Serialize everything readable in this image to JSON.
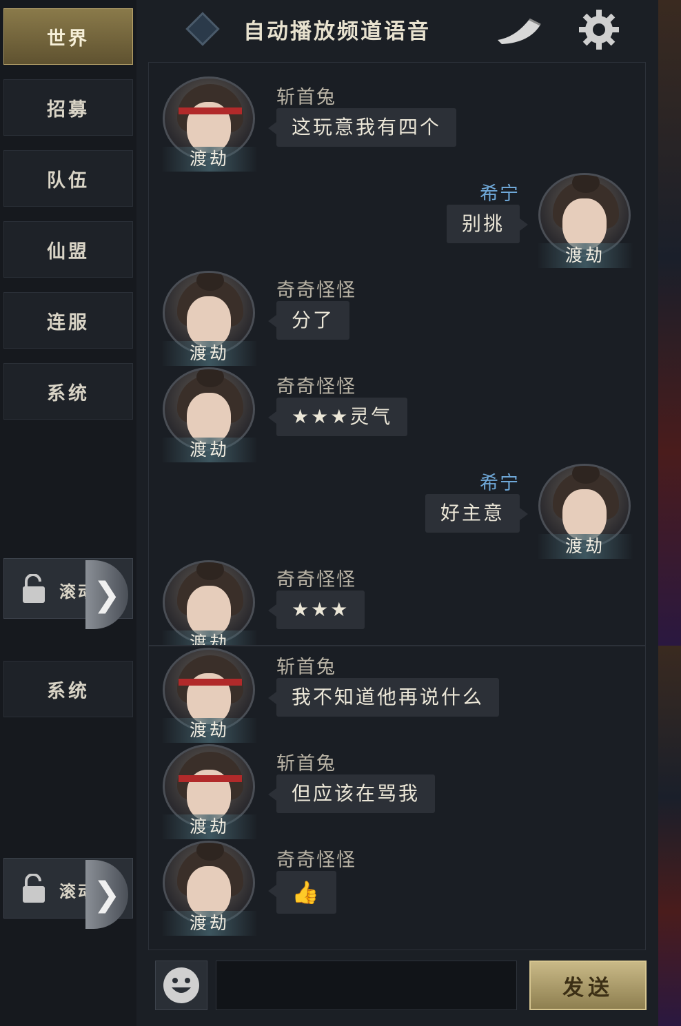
{
  "sidebar": {
    "tabs": [
      {
        "label": "世界",
        "active": true
      },
      {
        "label": "招募"
      },
      {
        "label": "队伍"
      },
      {
        "label": "仙盟"
      },
      {
        "label": "连服"
      },
      {
        "label": "系统"
      }
    ],
    "scroll_label": "滚动",
    "arrow_glyph": "❯"
  },
  "header": {
    "title": "自动播放频道语音",
    "icons": [
      "diamond-icon",
      "horn-icon",
      "gear-icon"
    ]
  },
  "avatar_label": "渡劫",
  "messages_top": [
    {
      "name": "斩首兔",
      "text": "这玩意我有四个",
      "side": "left",
      "avatar": "male"
    },
    {
      "name": "希宁",
      "text": "别挑",
      "side": "right",
      "avatar": "female"
    },
    {
      "name": "奇奇怪怪",
      "text": "分了",
      "side": "left",
      "avatar": "female"
    },
    {
      "name": "奇奇怪怪",
      "text": "★★★灵气",
      "side": "left",
      "avatar": "female"
    },
    {
      "name": "希宁",
      "text": "好主意",
      "side": "right",
      "avatar": "female"
    },
    {
      "name": "奇奇怪怪",
      "text": "★★★",
      "side": "left",
      "avatar": "female"
    }
  ],
  "bottom_panel": {
    "sidebar_tab": "系统",
    "scroll_label": "滚动",
    "messages": [
      {
        "name": "斩首兔",
        "text": "我不知道他再说什么",
        "side": "left",
        "avatar": "male"
      },
      {
        "name": "斩首兔",
        "text": "但应该在骂我",
        "side": "left",
        "avatar": "male"
      },
      {
        "name": "奇奇怪怪",
        "text": "👍",
        "side": "left",
        "avatar": "female",
        "is_emoji": true
      }
    ],
    "input": {
      "value": "",
      "placeholder": ""
    },
    "send_label": "发送"
  },
  "colors": {
    "active_tab": "#8a7a4a",
    "self_name": "#6fa8d8",
    "bubble": "#2c3037"
  }
}
